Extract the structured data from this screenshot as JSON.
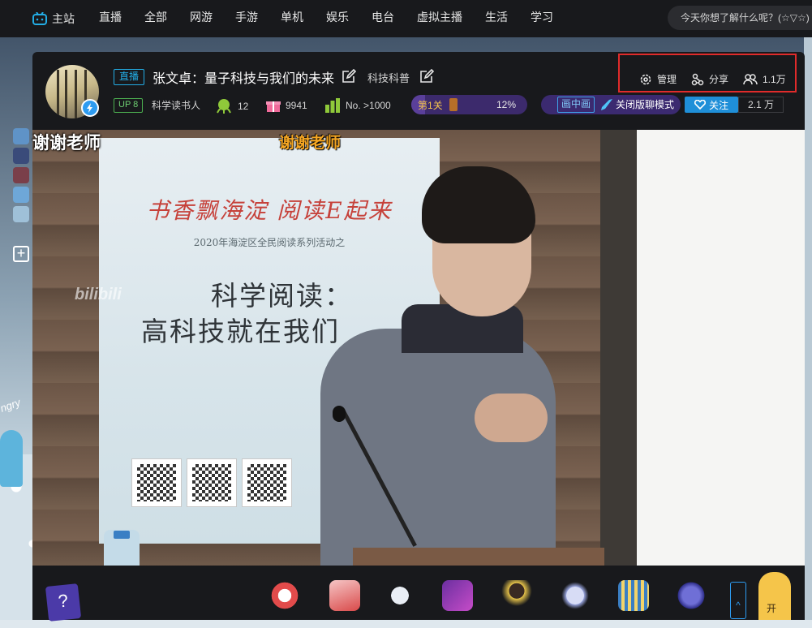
{
  "nav": {
    "items": [
      "主站",
      "直播",
      "全部",
      "网游",
      "手游",
      "单机",
      "娱乐",
      "电台",
      "虚拟主播",
      "生活",
      "学习"
    ],
    "search_placeholder": "今天你想了解什么呢？(☆▽☆)"
  },
  "room": {
    "live_tag": "直播",
    "title": "张文卓：量子科技与我们的未来",
    "area": "科技科普",
    "up_level": "UP 8",
    "up_name": "科学读书人",
    "stat_popularity": "12",
    "stat_gifts": "9941",
    "stat_rank": "No. >1000",
    "rank_label": "第1关",
    "rank_percent": "12%",
    "rank_progress": 0.12,
    "pip_label": "画中画",
    "mode_button": "关闭版聊模式",
    "follow_label": "关注",
    "follow_count": "2.1 万"
  },
  "tools": {
    "manage": "管理",
    "share": "分享",
    "viewers": "1.1万"
  },
  "video": {
    "danmaku_1": "谢谢老师",
    "danmaku_2": "谢谢老师",
    "watermark": "bilibili",
    "banner_red": "书香飘海淀  阅读E起来",
    "banner_sub": "2020年海淀区全民阅读系列活动之",
    "banner_title_1": "科学阅读：",
    "banner_title_2": "高科技就在我们"
  },
  "sidebar": {
    "plus_label": "+",
    "angry_text": "ngry"
  },
  "giftbar": {
    "card_symbol": "?",
    "expand_symbol": "^",
    "open_label": "开"
  },
  "colors": {
    "accent": "#23ade5",
    "highlight_box": "#e02b2b",
    "follow": "#1f8fd8"
  }
}
